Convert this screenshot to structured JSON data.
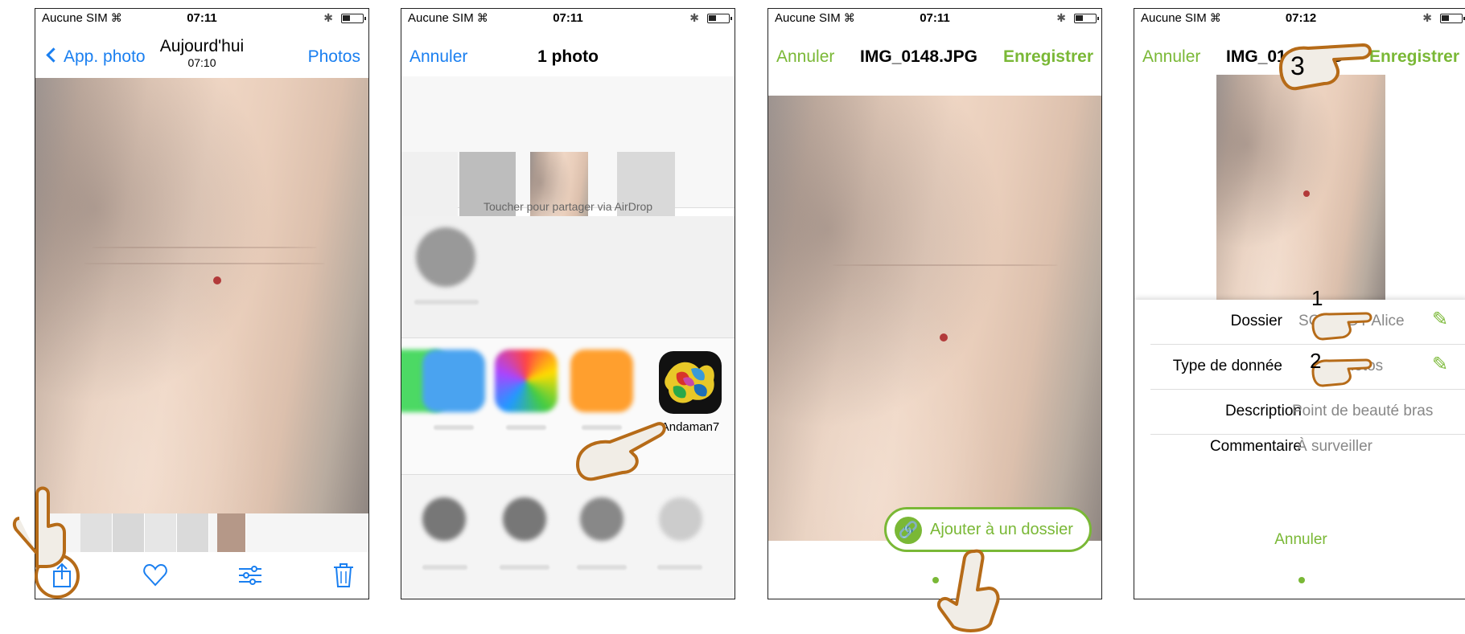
{
  "status_bars": [
    {
      "carrier": "Aucune SIM",
      "time": "07:11"
    },
    {
      "carrier": "Aucune SIM",
      "time": "07:11"
    },
    {
      "carrier": "Aucune SIM",
      "time": "07:11"
    },
    {
      "carrier": "Aucune SIM",
      "time": "07:12"
    }
  ],
  "screen1": {
    "back_label": "App. photo",
    "title": "Aujourd'hui",
    "subtitle": "07:10",
    "right_label": "Photos",
    "toolbar_icons": [
      "share-icon",
      "heart-icon",
      "sliders-icon",
      "trash-icon"
    ]
  },
  "screen2": {
    "cancel_label": "Annuler",
    "title": "1 photo",
    "airdrop_hint": "Toucher pour partager via AirDrop",
    "app_name": "Andaman7"
  },
  "screen3": {
    "cancel_label": "Annuler",
    "title": "IMG_0148.JPG",
    "save_label": "Enregistrer",
    "add_folder_label": "Ajouter à un dossier"
  },
  "screen4": {
    "cancel_label": "Annuler",
    "title": "IMG_0148.JPG",
    "save_label": "Enregistrer",
    "fields": [
      {
        "label": "Dossier",
        "value": "SCHMIDT Alice"
      },
      {
        "label": "Type de donnée",
        "value": "Photos"
      },
      {
        "label": "Description",
        "value": "Point de beauté bras"
      },
      {
        "label": "Commentaire",
        "value": "À surveiller"
      }
    ],
    "bottom_cancel": "Annuler"
  },
  "step_numbers": [
    "1",
    "2",
    "3"
  ],
  "colors": {
    "ios_blue": "#1a7ff0",
    "andaman_green": "#7ab836",
    "highlight_ring": "#b66b18"
  }
}
